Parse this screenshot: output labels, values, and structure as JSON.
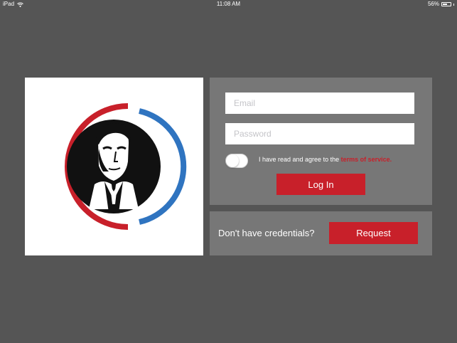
{
  "status_bar": {
    "device": "iPad",
    "time": "11:08 AM",
    "battery": "56%"
  },
  "logo": {
    "colors": {
      "red_arc": "#c8202a",
      "blue_arc": "#2f74c0",
      "portrait_bg": "#111111"
    }
  },
  "login": {
    "email_placeholder": "Email",
    "password_placeholder": "Password",
    "terms_prefix": "I have read and agree to the ",
    "terms_link": "terms of service.",
    "toggle_on": false,
    "login_label": "Log In"
  },
  "request": {
    "prompt": "Don't have credentials?",
    "button_label": "Request"
  },
  "colors": {
    "background": "#555555",
    "panel": "#777777",
    "accent": "#c8202a"
  }
}
